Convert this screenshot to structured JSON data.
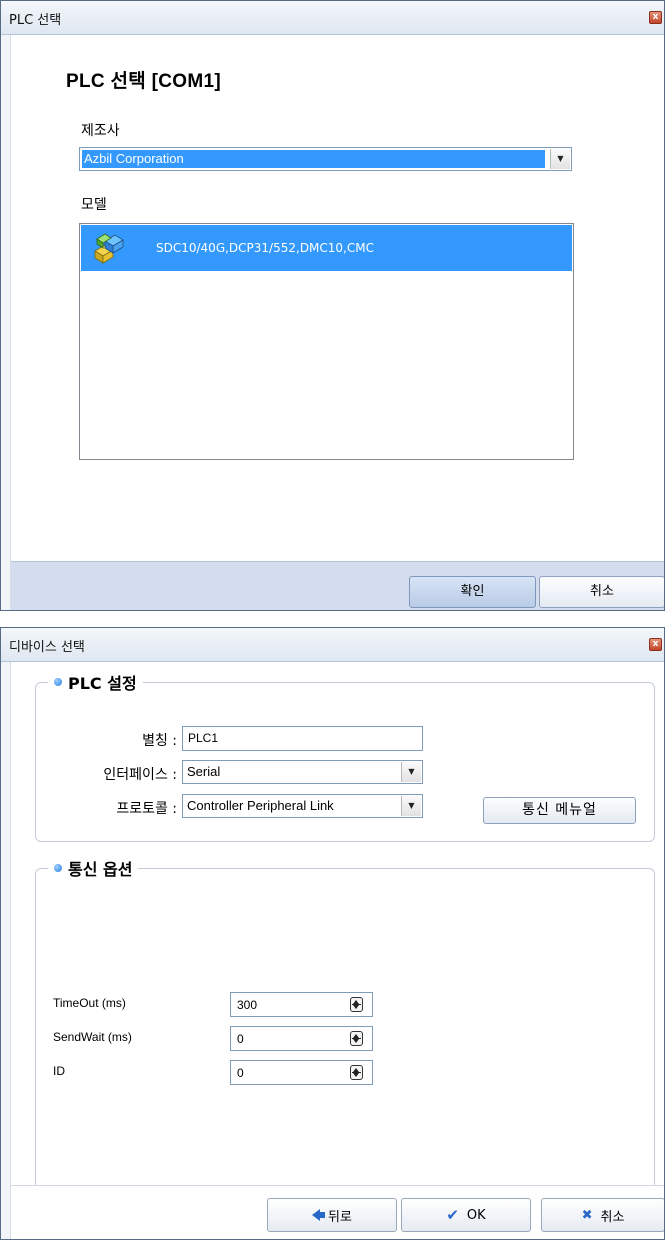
{
  "plc_dialog": {
    "title": "PLC 선택",
    "heading": "PLC 선택   [COM1]",
    "manufacturer_label": "제조사",
    "manufacturer_value": "Azbil Corporation",
    "model_label": "모델",
    "models": [
      "SDC10/40G,DCP31/552,DMC10,CMC"
    ],
    "ok_label": "확인",
    "cancel_label": "취소",
    "close_glyph": "x"
  },
  "device_dialog": {
    "title": "디바이스 선택",
    "close_glyph": "x",
    "plc_settings": {
      "title": "PLC 설정",
      "alias_label": "별칭 :",
      "alias_value": "PLC1",
      "interface_label": "인터페이스 :",
      "interface_value": "Serial",
      "protocol_label": "프로토콜 :",
      "protocol_value": "Controller Peripheral Link",
      "manual_button": "통신 메뉴얼"
    },
    "comm_options": {
      "title": "통신 옵션",
      "fields": [
        {
          "label": "TimeOut (ms)",
          "value": "300"
        },
        {
          "label": "SendWait (ms)",
          "value": "0"
        },
        {
          "label": "ID",
          "value": "0"
        }
      ]
    },
    "footer": {
      "back_label": "뒤로",
      "ok_label": "OK",
      "cancel_label": "취소"
    }
  },
  "colors": {
    "selection": "#3399ff",
    "footer_bg": "#d4dded",
    "accent_icon": "#2a68c8"
  }
}
